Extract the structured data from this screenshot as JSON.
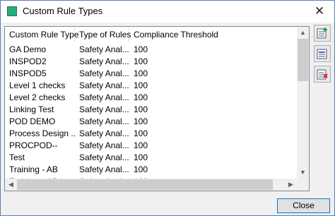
{
  "window": {
    "title": "Custom Rule Types",
    "close_glyph": "✕"
  },
  "table": {
    "columns": [
      "Custom Rule Type",
      "Type of Rules",
      "Compliance Threshold"
    ],
    "rows": [
      [
        "GA Demo",
        "Safety Anal...",
        "100"
      ],
      [
        "INSPOD2",
        "Safety Anal...",
        "100"
      ],
      [
        "INSPOD5",
        "Safety Anal...",
        "100"
      ],
      [
        "Level 1 checks",
        "Safety Anal...",
        "100"
      ],
      [
        "Level 2 checks",
        "Safety Anal...",
        "100"
      ],
      [
        "Linking Test",
        "Safety Anal...",
        "100"
      ],
      [
        "POD DEMO",
        "Safety Anal...",
        "100"
      ],
      [
        "Process Design ...",
        "Safety Anal...",
        "100"
      ],
      [
        "PROCPOD--",
        "Safety Anal...",
        "100"
      ],
      [
        "Test",
        "Safety Anal...",
        "100"
      ],
      [
        "Training - AB",
        "Safety Anal...",
        "100"
      ]
    ]
  },
  "side_buttons": [
    "add-rule-icon",
    "edit-rule-icon",
    "delete-rule-icon"
  ],
  "footer": {
    "close_label": "Close"
  },
  "colors": {
    "accent": "#0078d7",
    "app_icon": "#1fb07a",
    "delete_red": "#d42020",
    "add_green": "#19a34a"
  }
}
